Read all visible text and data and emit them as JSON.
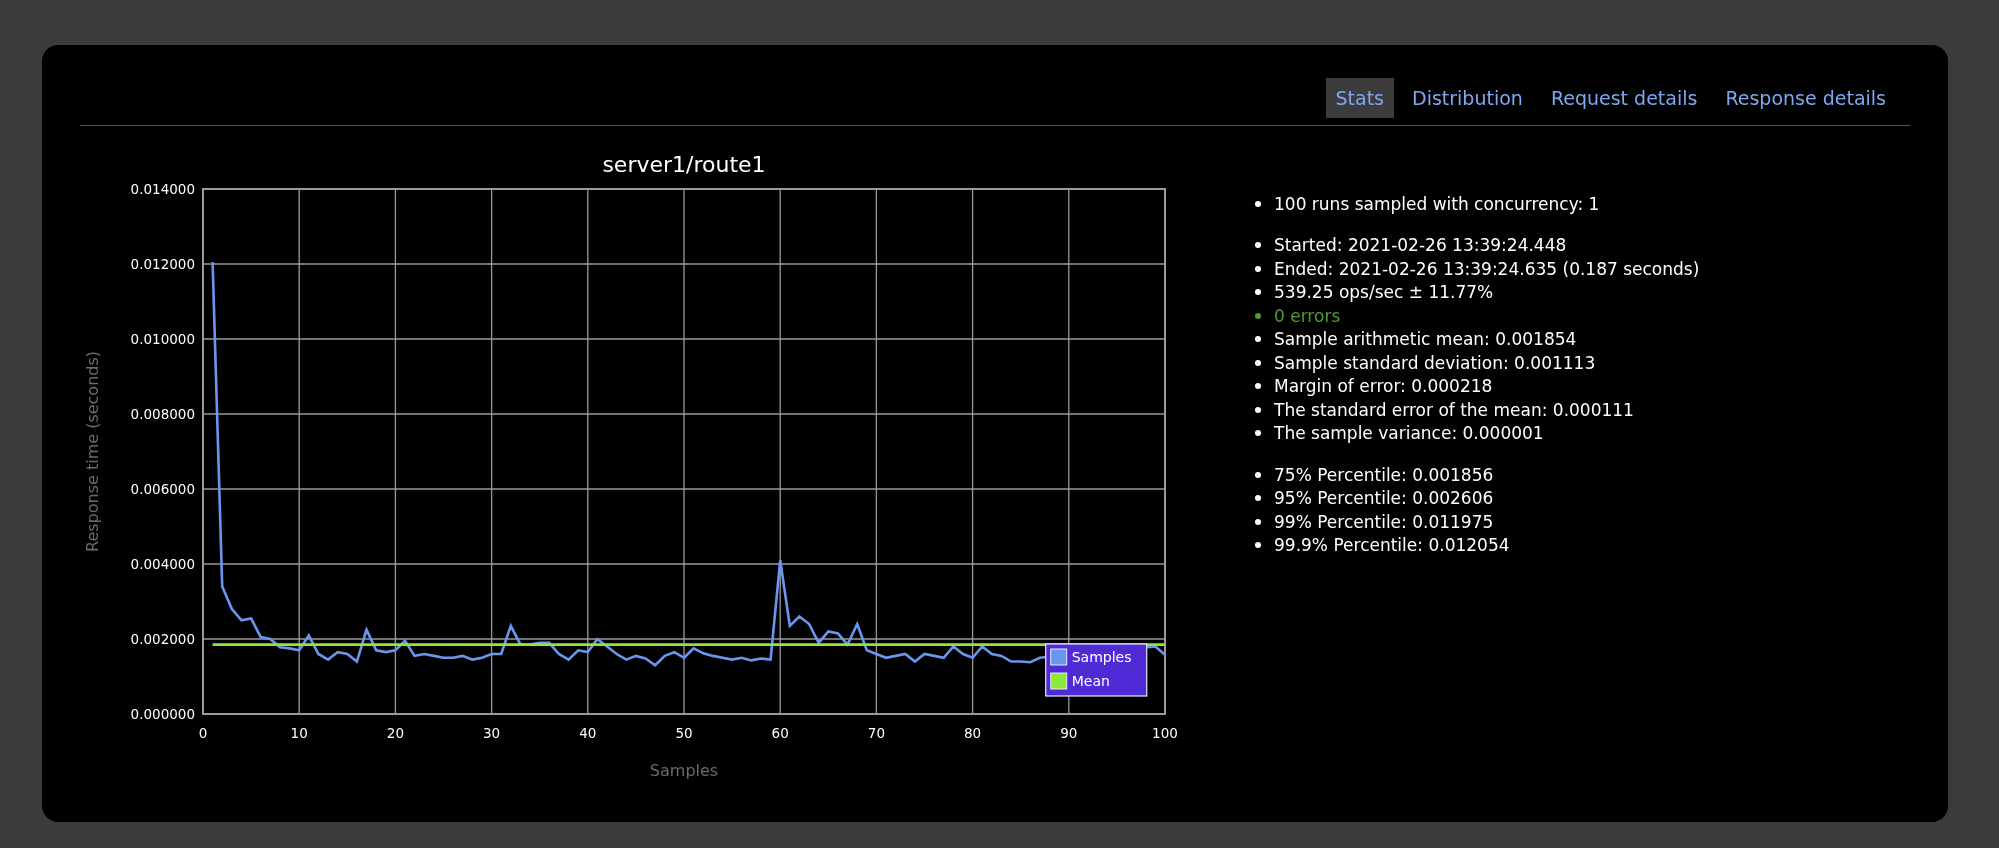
{
  "tabs": [
    {
      "label": "Stats",
      "selected": true
    },
    {
      "label": "Distribution",
      "selected": false
    },
    {
      "label": "Request details",
      "selected": false
    },
    {
      "label": "Response details",
      "selected": false
    }
  ],
  "chart": {
    "chart_data": {
      "type": "line",
      "title": "server1/route1",
      "xlabel": "Samples",
      "ylabel": "Response time (seconds)",
      "x": [
        1,
        2,
        3,
        4,
        5,
        6,
        7,
        8,
        9,
        10,
        11,
        12,
        13,
        14,
        15,
        16,
        17,
        18,
        19,
        20,
        21,
        22,
        23,
        24,
        25,
        26,
        27,
        28,
        29,
        30,
        31,
        32,
        33,
        34,
        35,
        36,
        37,
        38,
        39,
        40,
        41,
        42,
        43,
        44,
        45,
        46,
        47,
        48,
        49,
        50,
        51,
        52,
        53,
        54,
        55,
        56,
        57,
        58,
        59,
        60,
        61,
        62,
        63,
        64,
        65,
        66,
        67,
        68,
        69,
        70,
        71,
        72,
        73,
        74,
        75,
        76,
        77,
        78,
        79,
        80,
        81,
        82,
        83,
        84,
        85,
        86,
        87,
        99,
        100
      ],
      "series": [
        {
          "name": "Samples",
          "color": "#6b96ee",
          "values": [
            0.01205,
            0.0034,
            0.0028,
            0.0025,
            0.00255,
            0.00205,
            0.002,
            0.00178,
            0.00175,
            0.0017,
            0.0021,
            0.0016,
            0.00145,
            0.00165,
            0.0016,
            0.0014,
            0.00225,
            0.0017,
            0.00165,
            0.0017,
            0.00195,
            0.00155,
            0.0016,
            0.00155,
            0.0015,
            0.0015,
            0.00155,
            0.00145,
            0.0015,
            0.0016,
            0.0016,
            0.00235,
            0.00185,
            0.00185,
            0.0019,
            0.0019,
            0.0016,
            0.00145,
            0.0017,
            0.00165,
            0.002,
            0.0018,
            0.0016,
            0.00145,
            0.00155,
            0.00148,
            0.0013,
            0.00155,
            0.00165,
            0.0015,
            0.00175,
            0.00162,
            0.00155,
            0.0015,
            0.00145,
            0.0015,
            0.00143,
            0.00148,
            0.00145,
            0.0041,
            0.00235,
            0.0026,
            0.0024,
            0.0019,
            0.0022,
            0.00215,
            0.00185,
            0.0024,
            0.0017,
            0.0016,
            0.0015,
            0.00155,
            0.0016,
            0.0014,
            0.0016,
            0.00155,
            0.0015,
            0.0018,
            0.0016,
            0.0015,
            0.0018,
            0.0016,
            0.00155,
            0.0014,
            0.0014,
            0.00138,
            0.0015,
            0.0018,
            0.00158
          ]
        },
        {
          "name": "Mean",
          "color": "#8ee83a",
          "values": [
            0.00185,
            0.00185,
            0.00185,
            0.00185,
            0.00185,
            0.00185,
            0.00185,
            0.00185,
            0.00185,
            0.00185,
            0.00185,
            0.00185,
            0.00185,
            0.00185,
            0.00185,
            0.00185,
            0.00185,
            0.00185,
            0.00185,
            0.00185,
            0.00185,
            0.00185,
            0.00185,
            0.00185,
            0.00185,
            0.00185,
            0.00185,
            0.00185,
            0.00185,
            0.00185,
            0.00185,
            0.00185,
            0.00185,
            0.00185,
            0.00185,
            0.00185,
            0.00185,
            0.00185,
            0.00185,
            0.00185,
            0.00185,
            0.00185,
            0.00185,
            0.00185,
            0.00185,
            0.00185,
            0.00185,
            0.00185,
            0.00185,
            0.00185,
            0.00185,
            0.00185,
            0.00185,
            0.00185,
            0.00185,
            0.00185,
            0.00185,
            0.00185,
            0.00185,
            0.00185,
            0.00185,
            0.00185,
            0.00185,
            0.00185,
            0.00185,
            0.00185,
            0.00185,
            0.00185,
            0.00185,
            0.00185,
            0.00185,
            0.00185,
            0.00185,
            0.00185,
            0.00185,
            0.00185,
            0.00185,
            0.00185,
            0.00185,
            0.00185,
            0.00185,
            0.00185,
            0.00185,
            0.00185,
            0.00185,
            0.00185,
            0.00185,
            0.00185,
            0.00185
          ]
        }
      ],
      "xlim": [
        0,
        100
      ],
      "ylim": [
        0,
        0.014
      ],
      "xticks": [
        0,
        10,
        20,
        30,
        40,
        50,
        60,
        70,
        80,
        90,
        100
      ],
      "yticks": [
        {
          "value": 0,
          "label": "0.000000"
        },
        {
          "value": 0.002,
          "label": "0.002000"
        },
        {
          "value": 0.004,
          "label": "0.004000"
        },
        {
          "value": 0.006,
          "label": "0.006000"
        },
        {
          "value": 0.008,
          "label": "0.008000"
        },
        {
          "value": 0.01,
          "label": "0.010000"
        },
        {
          "value": 0.012,
          "label": "0.012000"
        },
        {
          "value": 0.014,
          "label": "0.014000"
        }
      ],
      "grid": true,
      "legend": true
    }
  },
  "stats": {
    "groups": [
      {
        "items": [
          {
            "text": "100 runs sampled with concurrency: 1",
            "kind": "plain"
          }
        ]
      },
      {
        "items": [
          {
            "text": "Started: 2021-02-26 13:39:24.448",
            "kind": "plain"
          },
          {
            "text": "Ended: 2021-02-26 13:39:24.635 (0.187 seconds)",
            "kind": "plain"
          },
          {
            "text": "539.25 ops/sec ± 11.77%",
            "kind": "plain"
          },
          {
            "text": "0 errors",
            "kind": "success"
          },
          {
            "text": "Sample arithmetic mean: 0.001854",
            "kind": "plain"
          },
          {
            "text": "Sample standard deviation: 0.001113",
            "kind": "plain"
          },
          {
            "text": "Margin of error: 0.000218",
            "kind": "plain"
          },
          {
            "text": "The standard error of the mean: 0.000111",
            "kind": "plain"
          },
          {
            "text": "The sample variance: 0.000001",
            "kind": "plain"
          }
        ]
      },
      {
        "items": [
          {
            "text": "75% Percentile: 0.001856",
            "kind": "plain"
          },
          {
            "text": "95% Percentile: 0.002606",
            "kind": "plain"
          },
          {
            "text": "99% Percentile: 0.011975",
            "kind": "plain"
          },
          {
            "text": "99.9% Percentile: 0.012054",
            "kind": "plain"
          }
        ]
      }
    ]
  }
}
